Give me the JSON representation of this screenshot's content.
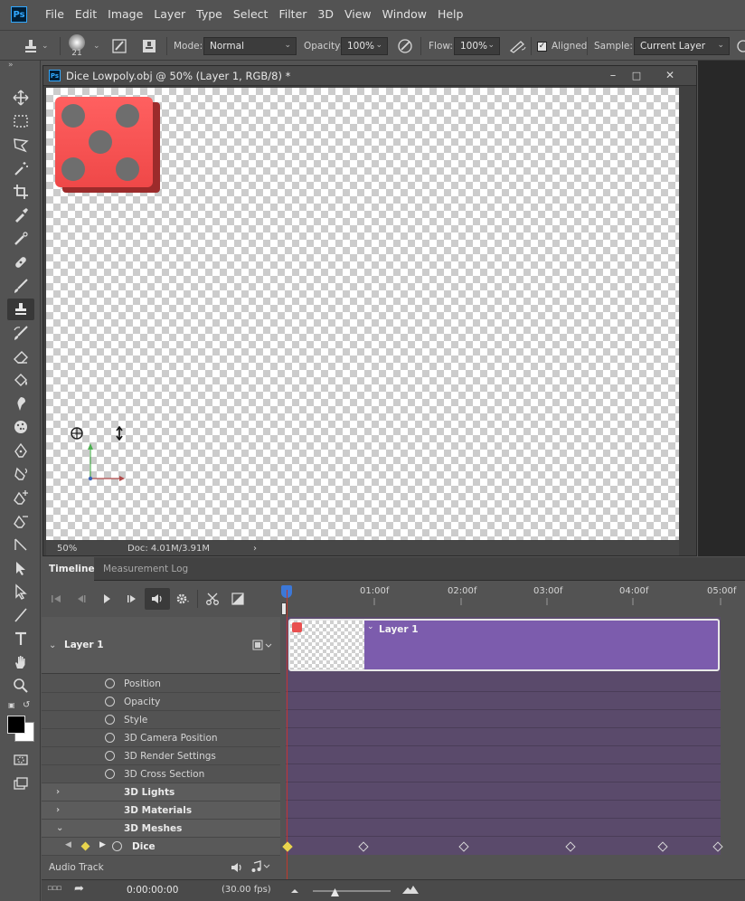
{
  "app": {
    "logo": "Ps",
    "menu": [
      "File",
      "Edit",
      "Image",
      "Layer",
      "Type",
      "Select",
      "Filter",
      "3D",
      "View",
      "Window",
      "Help"
    ]
  },
  "options": {
    "brush_size": "21",
    "mode_label": "Mode:",
    "mode_value": "Normal",
    "opacity_label": "Opacity:",
    "opacity_value": "100%",
    "flow_label": "Flow:",
    "flow_value": "100%",
    "aligned_label": "Aligned",
    "sample_label": "Sample:",
    "sample_value": "Current Layer"
  },
  "document": {
    "title": "Dice Lowpoly.obj @ 50% (Layer 1, RGB/8) *",
    "zoom": "50%",
    "doc_size": "Doc: 4.01M/3.91M",
    "win_minimize": "–",
    "win_maximize": "□",
    "win_close": "✕"
  },
  "timeline": {
    "tabs": [
      "Timeline",
      "Measurement Log"
    ],
    "ruler_labels": [
      "01:00f",
      "02:00f",
      "03:00f",
      "04:00f",
      "05:00f"
    ],
    "layer_name": "Layer 1",
    "clip_label": "Layer 1",
    "properties": [
      "Position",
      "Opacity",
      "Style",
      "3D Camera Position",
      "3D Render Settings",
      "3D Cross Section"
    ],
    "groups": [
      "3D Lights",
      "3D Materials",
      "3D Meshes"
    ],
    "mesh_item": "Dice",
    "audio_track": "Audio Track",
    "timecode": "0:00:00:00",
    "fps": "(30.00 fps)"
  },
  "colors": {
    "accent": "#31a8ff",
    "clip": "#7c5cad",
    "playhead": "#c0392b",
    "dice_red": "#f05252",
    "dice_pip": "#6b6b6b"
  }
}
